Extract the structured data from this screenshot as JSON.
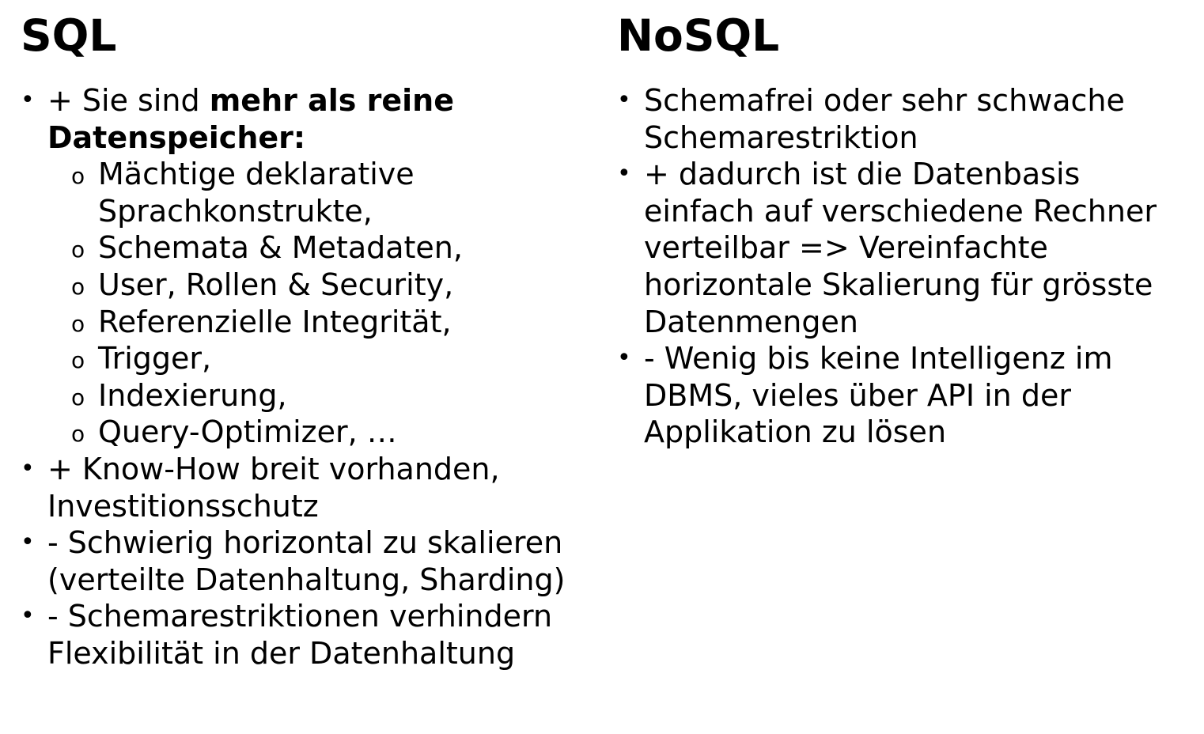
{
  "sql": {
    "title": "SQL",
    "bullet_glyph": "•",
    "sub_bullet_glyph": "o",
    "item1": {
      "prefix": "+ Sie sind ",
      "bold_text": "mehr als reine Datenspeicher:",
      "subitems": [
        "Mächtige deklarative Sprachkonstrukte,",
        "Schemata & Metadaten,",
        "User, Rollen & Security,",
        "Referenzielle Integrität,",
        "Trigger,",
        "Indexierung,",
        "Query-Optimizer, …"
      ]
    },
    "item2": "+ Know-How breit vorhanden, Investitionsschutz",
    "item3": "- Schwierig horizontal zu skalieren (verteilte Datenhaltung, Sharding)",
    "item4": "- Schemarestriktionen verhindern Flexibilität in der Datenhaltung"
  },
  "nosql": {
    "title": "NoSQL",
    "bullet_glyph": "•",
    "item1": "Schemafrei oder sehr schwache Schemarestriktion",
    "item2": "+ dadurch ist die Datenbasis einfach auf verschiedene Rechner verteilbar => Vereinfachte horizontale Skalierung für grösste Datenmengen",
    "item3": "- Wenig bis keine Intelligenz im DBMS, vieles über API in der Applikation zu lösen"
  }
}
